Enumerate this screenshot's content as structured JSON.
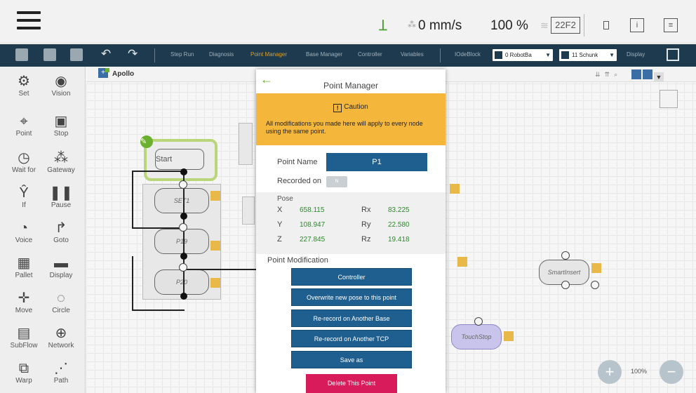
{
  "topbar": {
    "speed": "0 mm/s",
    "percent": "100 %",
    "code": "22F2"
  },
  "toolbar": {
    "links": [
      "Step Run",
      "Diagnosis",
      "Point Manager",
      "Base Manager",
      "Controller",
      "Variables",
      "IOdeBlock"
    ],
    "active_link": "Point Manager",
    "robot_select": "0 RobotBa",
    "tool_select": "11 Schunk",
    "display_label": "Display"
  },
  "palette": {
    "items": [
      {
        "label": "Set",
        "icon": "set-icon"
      },
      {
        "label": "Vision",
        "icon": "vision-icon"
      },
      {
        "label": "Point",
        "icon": "point-icon"
      },
      {
        "label": "Stop",
        "icon": "stop-icon"
      },
      {
        "label": "Wait for",
        "icon": "wait-icon"
      },
      {
        "label": "Gateway",
        "icon": "gateway-icon"
      },
      {
        "label": "If",
        "icon": "if-icon"
      },
      {
        "label": "Pause",
        "icon": "pause-icon"
      },
      {
        "label": "Voice",
        "icon": "voice-icon"
      },
      {
        "label": "Goto",
        "icon": "goto-icon"
      },
      {
        "label": "Pallet",
        "icon": "pallet-icon"
      },
      {
        "label": "Display",
        "icon": "display-icon"
      },
      {
        "label": "Move",
        "icon": "move-icon"
      },
      {
        "label": "Circle",
        "icon": "circle-icon"
      },
      {
        "label": "SubFlow",
        "icon": "subflow-icon"
      },
      {
        "label": "Network",
        "icon": "network-icon"
      },
      {
        "label": "Warp",
        "icon": "warp-icon"
      },
      {
        "label": "Path",
        "icon": "path-icon"
      }
    ]
  },
  "canvas": {
    "tab_name": "Apollo",
    "nodes": {
      "start": "Start",
      "set1": "SET1",
      "p19": "P19",
      "p20": "P20",
      "smartinsert": "SmartInsert",
      "touchstop": "TouchStop"
    },
    "zoom": "100%"
  },
  "modal": {
    "title": "Point Manager",
    "caution_title": "Caution",
    "caution_text": "All modifications you made here will apply to every node using the same point.",
    "point_name_label": "Point Name",
    "point_name_value": "P1",
    "recorded_on_label": "Recorded on",
    "recorded_on_value": "N",
    "pose_label": "Pose",
    "pose": {
      "x_label": "X",
      "x": "658.115",
      "y_label": "Y",
      "y": "108.947",
      "z_label": "Z",
      "z": "227.845",
      "rx_label": "Rx",
      "rx": "83.225",
      "ry_label": "Ry",
      "ry": "22.580",
      "rz_label": "Rz",
      "rz": "19.418"
    },
    "modification_label": "Point Modification",
    "buttons": [
      "Controller",
      "Overwrite new pose to this point",
      "Re-record on Another Base",
      "Re-record on Another TCP",
      "Save as"
    ],
    "delete_label": "Delete This Point"
  },
  "colors": {
    "toolbar_bg": "#1e3a4f",
    "accent_blue": "#1f5f8f",
    "caution": "#f4b73b",
    "delete": "#d81b5a",
    "pose_value": "#2a8a2a",
    "start_border": "#b9d77a"
  }
}
